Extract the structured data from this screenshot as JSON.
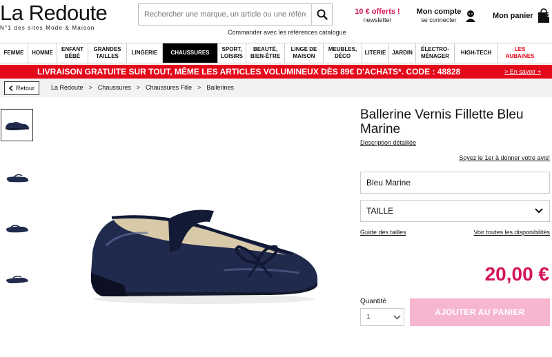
{
  "header": {
    "logo": "La Redoute",
    "tagline": "N°1 des sites Mode & Maison",
    "search_placeholder": "Rechercher une marque, un article ou une référence",
    "catalog_link": "Commander avec les références catalogue",
    "offer_title": "10 € offerts !",
    "offer_sub": "newsletter",
    "account_title": "Mon compte",
    "account_sub": "se connecter",
    "cart_label": "Mon panier",
    "cart_count": "1"
  },
  "nav": {
    "items": [
      {
        "label": "FEMME"
      },
      {
        "label": "HOMME"
      },
      {
        "label": "ENFANT BÉBÉ"
      },
      {
        "label": "GRANDES TAILLES"
      },
      {
        "label": "LINGERIE"
      },
      {
        "label": "CHAUSSURES"
      },
      {
        "label": "SPORT, LOISIRS"
      },
      {
        "label": "BEAUTÉ, BIEN-ÊTRE"
      },
      {
        "label": "LINGE DE MAISON"
      },
      {
        "label": "MEUBLES, DÉCO"
      },
      {
        "label": "LITERIE"
      },
      {
        "label": "JARDIN"
      },
      {
        "label": "ÉLECTRO-MÉNAGER"
      },
      {
        "label": "HIGH-TECH"
      },
      {
        "label": "LES AUBAINES"
      }
    ],
    "active": "CHAUSSURES"
  },
  "banner": {
    "text": "LIVRAISON GRATUITE SUR TOUT, MÊME LES ARTICLES VOLUMINEUX DÈS 89€ D'ACHATS*.   CODE : 48828",
    "link": "> En savoir +"
  },
  "breadcrumb": {
    "back": "Retour",
    "items": [
      "La Redoute",
      "Chaussures",
      "Chaussures Fille",
      "Ballerines"
    ],
    "separator": ">"
  },
  "product": {
    "title": "Ballerine Vernis Fillette Bleu Marine",
    "description_link": "Description détaillée",
    "review_link": "Soyez le 1er à donner votre avis!",
    "color": "Bleu Marine",
    "size_label": "TAILLE",
    "size_guide": "Guide des tailles",
    "availability_link": "Voir toutes les disponibilités",
    "price": "20,00 €",
    "quantity_label": "Quantité",
    "quantity_value": "1",
    "add_to_cart": "AJOUTER AU PANIER"
  },
  "colors": {
    "brand_red": "#e3081a",
    "price_pink": "#d4145a",
    "button_pink": "#f7b6cf",
    "shoe_navy": "#1f2a4d"
  }
}
